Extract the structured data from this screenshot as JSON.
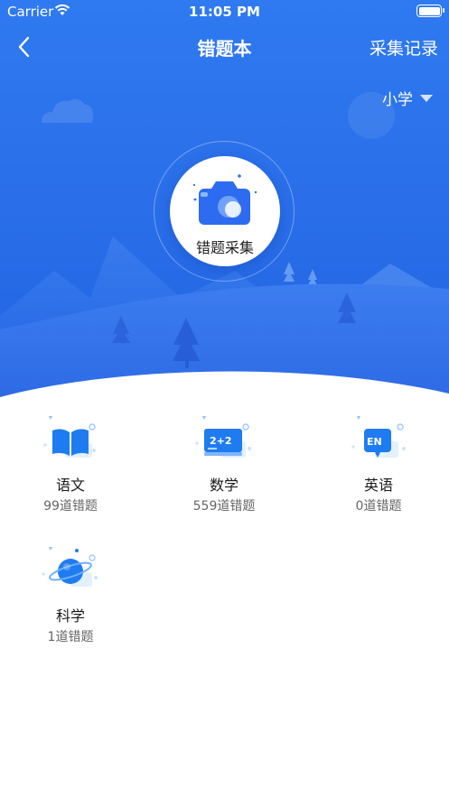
{
  "status_bar": {
    "carrier": "Carrier",
    "time": "11:05 PM"
  },
  "nav": {
    "title": "错题本",
    "action_label": "采集记录"
  },
  "grade_selector": {
    "value": "小学"
  },
  "capture": {
    "label": "错题采集"
  },
  "subjects": [
    {
      "name": "语文",
      "count": "99道错题",
      "icon": "book-icon"
    },
    {
      "name": "数学",
      "count": "559道错题",
      "icon": "math-board-icon"
    },
    {
      "name": "英语",
      "count": "0道错题",
      "icon": "en-bubble-icon"
    },
    {
      "name": "科学",
      "count": "1道错题",
      "icon": "planet-icon"
    }
  ],
  "colors": {
    "primary": "#2a6fe9",
    "icon_blue": "#1f7cf0",
    "text": "#1a1a1a",
    "muted": "#666666"
  }
}
